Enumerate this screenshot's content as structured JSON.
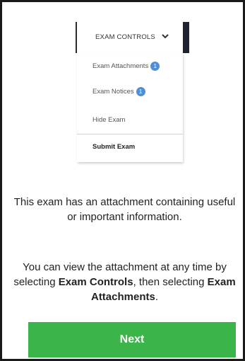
{
  "menu": {
    "header_label": "EXAM CONTROLS",
    "items": [
      {
        "label": "Exam Attachments",
        "badge": "1"
      },
      {
        "label": "Exam Notices",
        "badge": "1"
      },
      {
        "label": "Hide Exam",
        "badge": ""
      },
      {
        "label": "Submit Exam",
        "badge": ""
      }
    ]
  },
  "message": {
    "paragraph1": "This exam has an attachment containing useful or important information.",
    "paragraph2_part1": "You can view the attachment at any time by selecting ",
    "paragraph2_bold1": "Exam Controls",
    "paragraph2_part2": ", then selecting ",
    "paragraph2_bold2": "Exam Attachments",
    "paragraph2_part3": "."
  },
  "next_button": {
    "label": "Next"
  },
  "colors": {
    "next_button_bg": "#3bb54a",
    "badge_bg": "#4e8fd6"
  },
  "icons": {
    "chevron": "chevron-down-icon"
  }
}
